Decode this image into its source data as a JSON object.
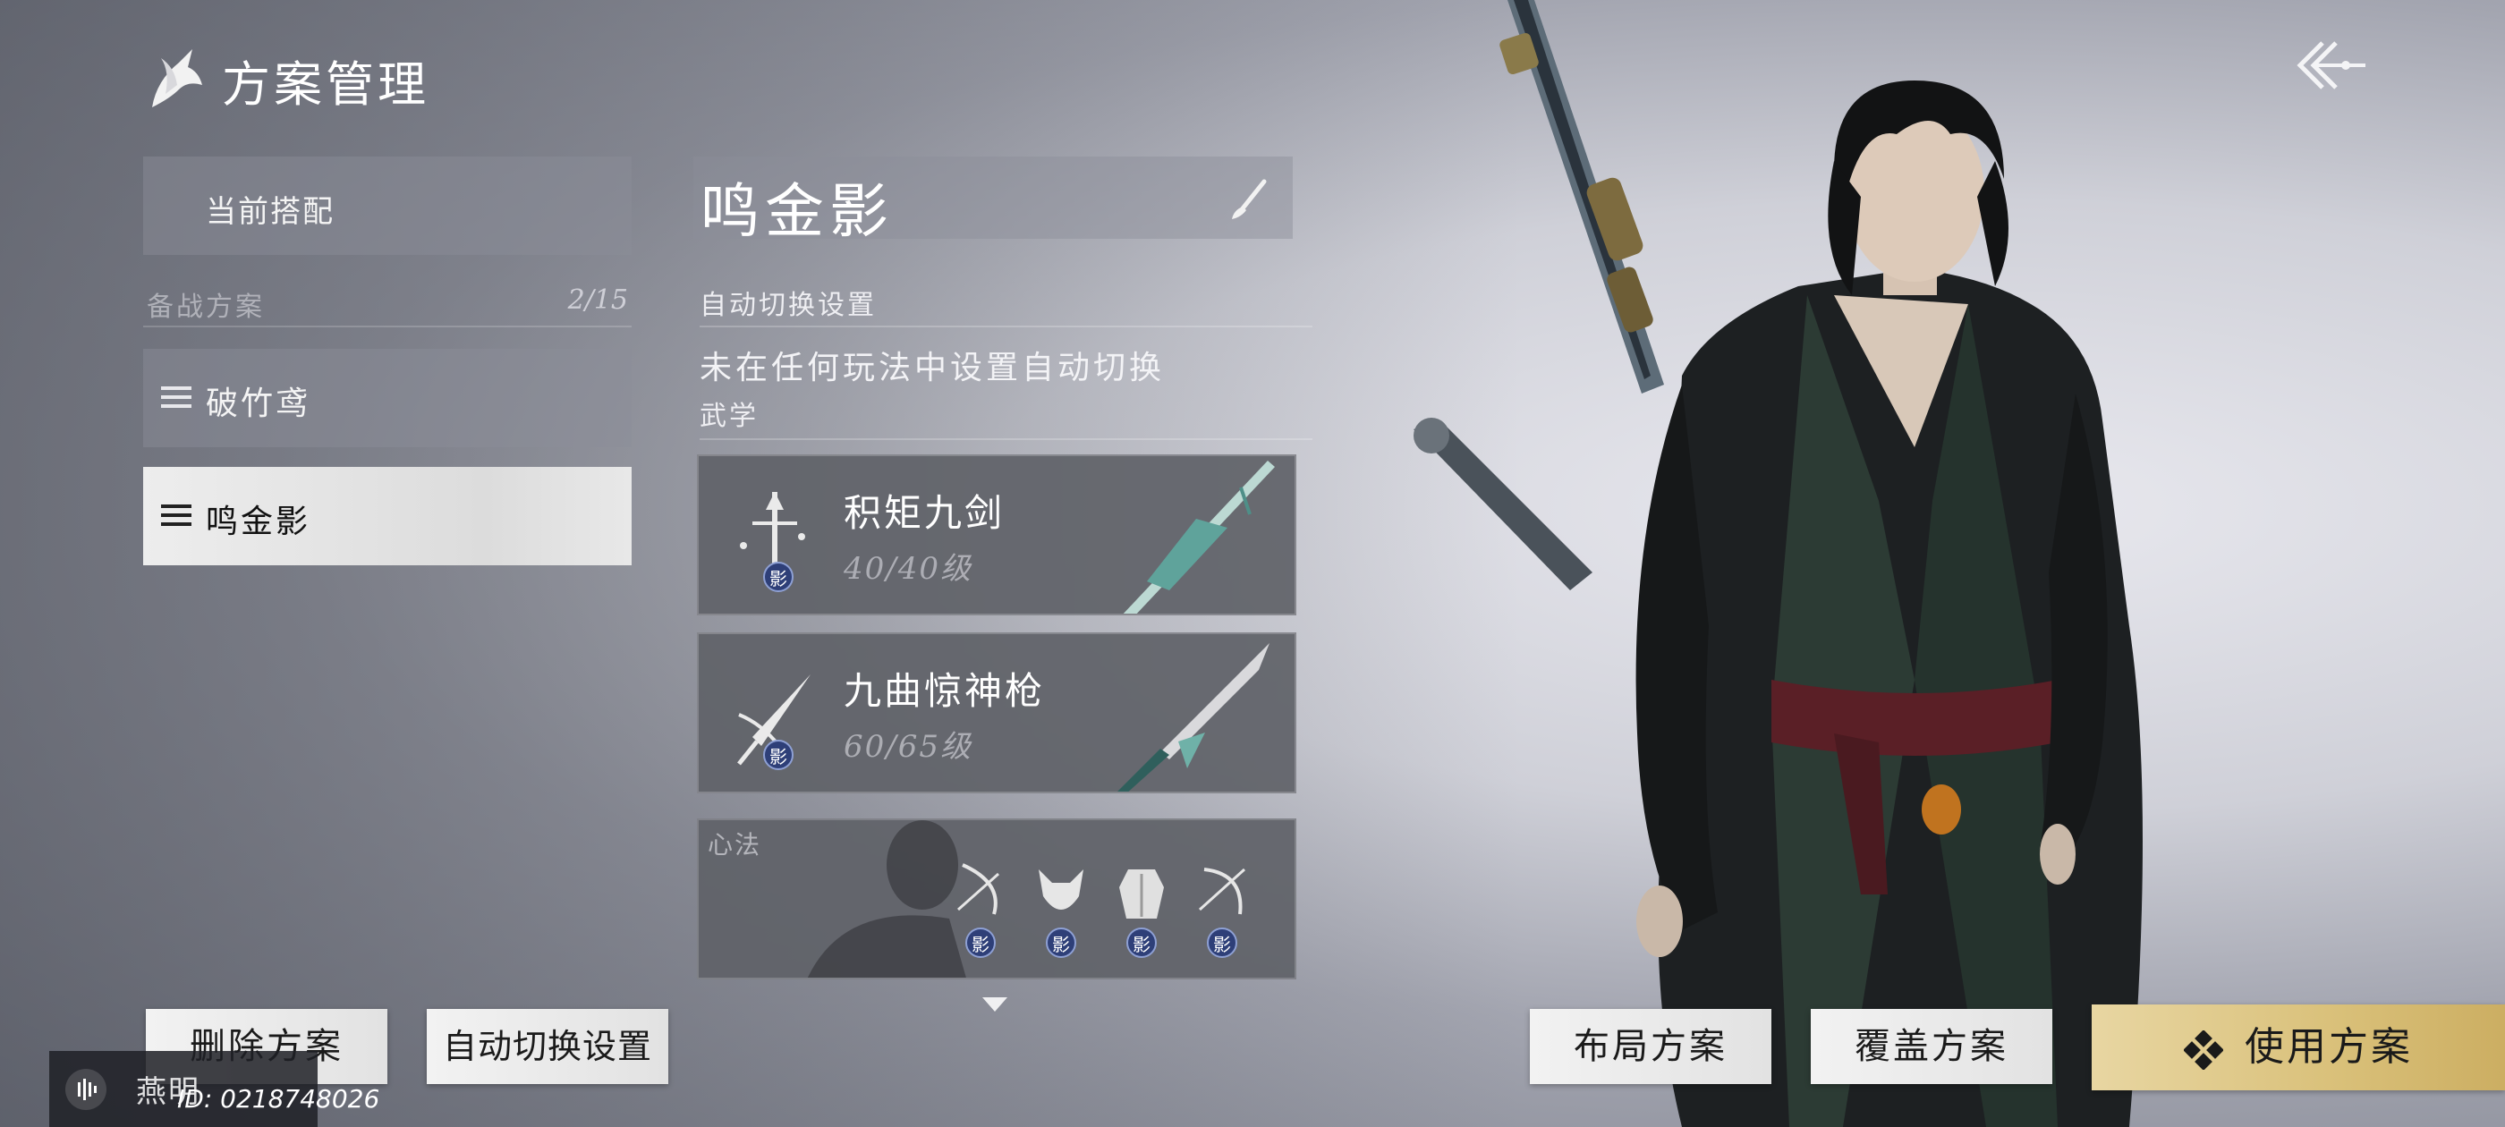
{
  "header": {
    "title": "方案管理"
  },
  "left_panel": {
    "current_label": "当前搭配",
    "section_label": "备战方案",
    "section_count": "2/15",
    "plans": [
      {
        "name": "破竹鸢",
        "selected": false
      },
      {
        "name": "鸣金影",
        "selected": true
      }
    ]
  },
  "detail": {
    "plan_name": "鸣金影",
    "auto_switch_header": "自动切换设置",
    "auto_switch_text": "未在任何玩法中设置自动切换",
    "martial_header": "武学",
    "weapons": [
      {
        "name": "积矩九剑",
        "level": "40/40级",
        "badge": "影"
      },
      {
        "name": "九曲惊神枪",
        "level": "60/65级",
        "badge": "影"
      }
    ],
    "xinfa_label": "心法",
    "xinfa_badges": [
      "影",
      "影",
      "影",
      "影"
    ]
  },
  "buttons": {
    "delete": "删除方案",
    "auto_switch": "自动切换设置",
    "layout": "布局方案",
    "cover": "覆盖方案",
    "use": "使用方案"
  },
  "user": {
    "name": "燕明",
    "id": "ID: 0218748026"
  },
  "colors": {
    "accent_gold": "#d9c079",
    "badge_blue": "#2e3f78"
  }
}
